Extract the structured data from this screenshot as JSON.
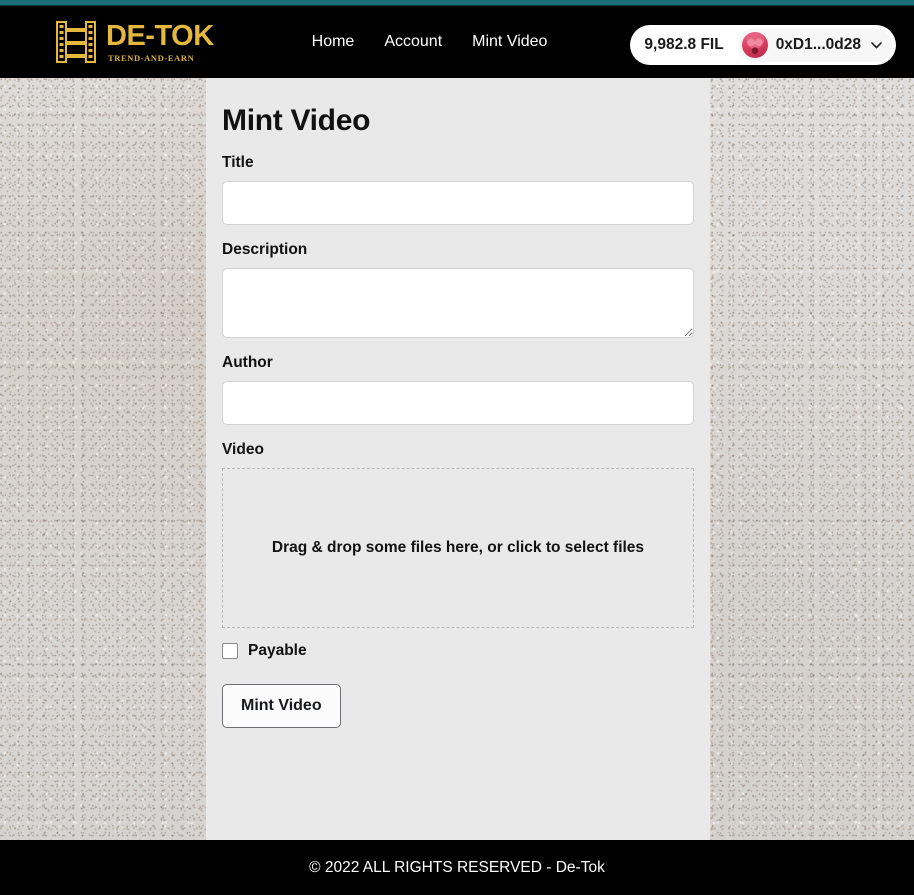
{
  "navbar": {
    "brand": {
      "name": "DE-TOK",
      "tagline": "TREND-AND-EARN",
      "icon": "film-strip-icon",
      "color": "#e3b83c"
    },
    "links": [
      {
        "label": "Home"
      },
      {
        "label": "Account"
      },
      {
        "label": "Mint Video"
      }
    ],
    "wallet": {
      "balance": "9,982.8 FIL",
      "address": "0xD1...0d28",
      "avatar_icon": "wallet-avatar-icon",
      "chevron_icon": "chevron-down-icon"
    },
    "background": "#000000",
    "top_strip_color": "#1b6f78"
  },
  "main": {
    "card": {
      "title": "Mint Video",
      "background": "#e9e9e9",
      "fields": [
        {
          "label": "Title",
          "type": "text",
          "value": "",
          "placeholder": ""
        },
        {
          "label": "Description",
          "type": "textarea",
          "value": "",
          "placeholder": ""
        },
        {
          "label": "Author",
          "type": "text",
          "value": "",
          "placeholder": ""
        },
        {
          "label": "Video",
          "type": "dropzone",
          "dropzone_text": "Drag & drop some files here, or click to select files"
        }
      ],
      "checkbox": {
        "label": "Payable",
        "checked": false
      },
      "submit_button": {
        "label": "Mint Video"
      }
    }
  },
  "footer": {
    "text": "© 2022 ALL RIGHTS RESERVED - De-Tok",
    "background": "#000000"
  }
}
